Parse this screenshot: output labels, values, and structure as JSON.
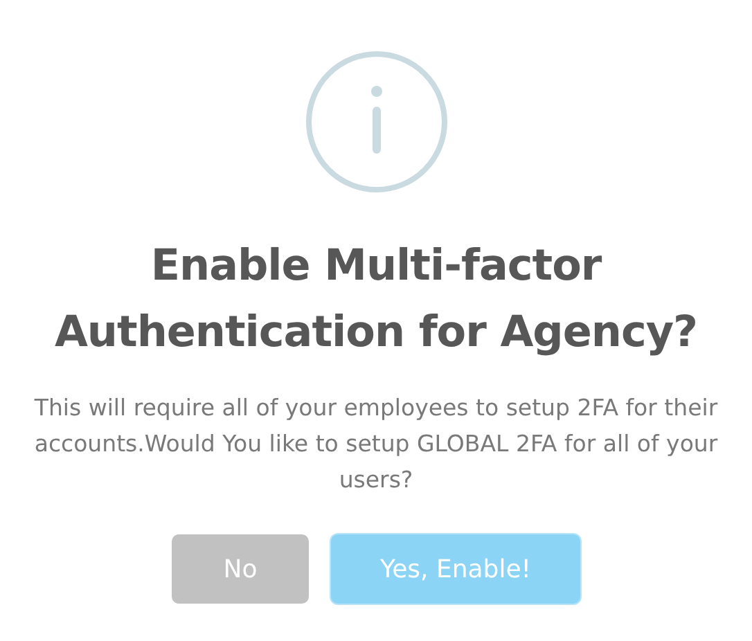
{
  "dialog": {
    "title": "Enable Multi-factor Authentication for Agency?",
    "message": "This will require all of your employees to setup 2FA for their accounts.Would You like to setup GLOBAL 2FA for all of your users?",
    "buttons": [
      {
        "label": "No",
        "kind": "cancel"
      },
      {
        "label": "Yes, Enable!",
        "kind": "confirm"
      }
    ]
  }
}
